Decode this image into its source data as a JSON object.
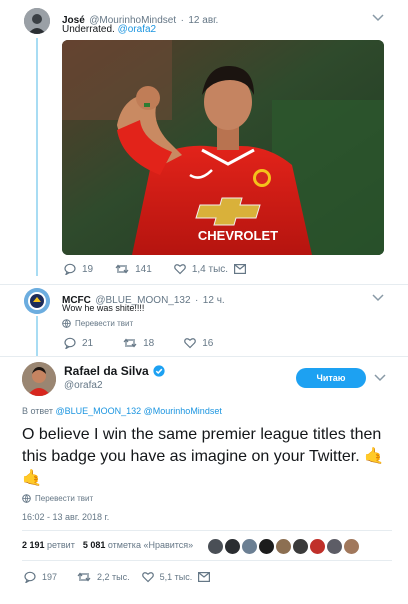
{
  "tweet1": {
    "author_name": "José",
    "author_handle": "@MourinhoMindset",
    "sep": "·",
    "date": "12 авг.",
    "text": "Underrated.",
    "mention": "@orafa2",
    "photo_shirt_text": "CHEVROLET",
    "reply_count": "19",
    "retweet_count": "141",
    "like_count": "1,4 тыс."
  },
  "tweet2": {
    "author_name": "MCFC",
    "author_handle": "@BLUE_MOON_132",
    "sep": "·",
    "date": "12 ч.",
    "text": "Wow he was shite!!!!",
    "translate_label": "Перевести твит",
    "reply_count": "21",
    "retweet_count": "18",
    "like_count": "16"
  },
  "main": {
    "author_name": "Rafael da Silva",
    "author_handle": "@orafa2",
    "follow_label": "Читаю",
    "reply_prefix": "В ответ",
    "reply_to_1": "@BLUE_MOON_132",
    "reply_to_2": "@MourinhoMindset",
    "text": "O believe I win the same premier league titles then this badge you have as imagine on your Twitter.",
    "emoji": "🤙🤙",
    "translate_label": "Перевести твит",
    "timestamp": "16:02 - 13 авг. 2018 г.",
    "retweets_number": "2 191",
    "retweets_label": "ретвит",
    "likes_number": "5 081",
    "likes_label": "отметка «Нравится»",
    "reply_count": "197",
    "retweet_count": "2,2 тыс.",
    "like_count": "5,1 тыс."
  },
  "colors": {
    "accent": "#1da1f2",
    "link": "#1b95e0",
    "thread_line": "#a8dcf3",
    "muted": "#657786",
    "verified": "#1da1f2",
    "emoji": "#f5b324"
  }
}
